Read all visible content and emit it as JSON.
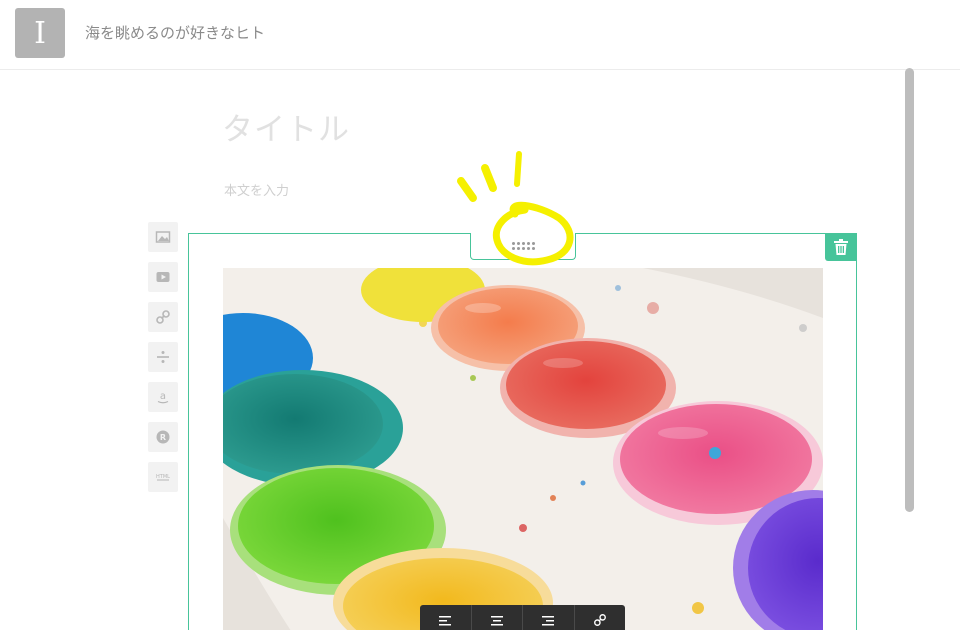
{
  "header": {
    "avatar_letter": "I",
    "blog_name": "海を眺めるのが好きなヒト"
  },
  "editor": {
    "title_placeholder": "タイトル",
    "body_placeholder": "本文を入力"
  },
  "insert_toolbar": {
    "items": [
      {
        "icon": "image-icon"
      },
      {
        "icon": "video-icon"
      },
      {
        "icon": "link-icon"
      },
      {
        "icon": "divider-icon"
      },
      {
        "icon": "amazon-icon",
        "label": "a"
      },
      {
        "icon": "rakuten-icon",
        "label": "R"
      },
      {
        "icon": "html-icon",
        "label": "HTML"
      }
    ]
  },
  "image_block": {
    "accent_color": "#47c49a",
    "photo_subject": "watercolor paint palette"
  },
  "align_toolbar": {
    "items": [
      {
        "icon": "align-left-icon"
      },
      {
        "icon": "align-center-icon"
      },
      {
        "icon": "align-right-icon"
      },
      {
        "icon": "link-icon"
      }
    ]
  },
  "annotation_color": "#f5f000"
}
